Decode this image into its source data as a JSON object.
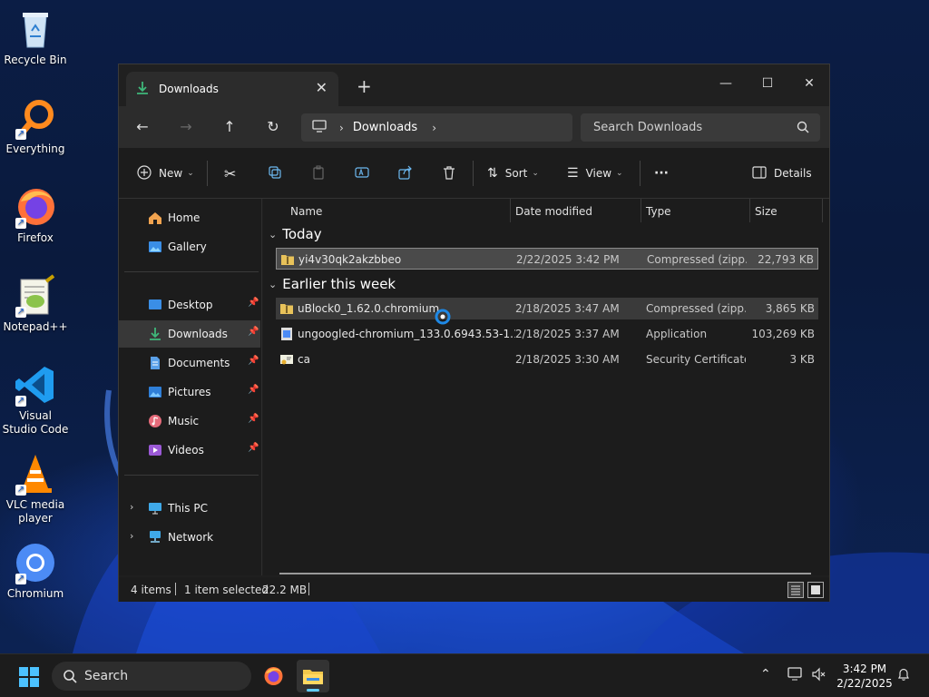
{
  "desktop": {
    "icons": [
      {
        "label": "Recycle Bin",
        "icon": "recycle-bin-icon"
      },
      {
        "label": "Everything",
        "icon": "everything-search-icon"
      },
      {
        "label": "Firefox",
        "icon": "firefox-icon"
      },
      {
        "label": "Notepad++",
        "icon": "notepad-plus-plus-icon"
      },
      {
        "label": "Visual Studio Code",
        "icon": "vscode-icon"
      },
      {
        "label": "VLC media player",
        "icon": "vlc-icon"
      },
      {
        "label": "Chromium",
        "icon": "chromium-icon"
      }
    ]
  },
  "window": {
    "tab_title": "Downloads",
    "address": {
      "segment": "Downloads"
    },
    "search_placeholder": "Search Downloads",
    "toolbar": {
      "new_label": "New",
      "sort_label": "Sort",
      "view_label": "View",
      "more_label": "···",
      "details_label": "Details"
    },
    "nav": {
      "home": "Home",
      "gallery": "Gallery",
      "desktop": "Desktop",
      "downloads": "Downloads",
      "documents": "Documents",
      "pictures": "Pictures",
      "music": "Music",
      "videos": "Videos",
      "this_pc": "This PC",
      "network": "Network"
    },
    "columns": {
      "name": "Name",
      "date": "Date modified",
      "type": "Type",
      "size": "Size"
    },
    "groups": {
      "today": {
        "label": "Today",
        "files": [
          {
            "name": "yi4v30qk2akzbbeo",
            "date": "2/22/2025 3:42 PM",
            "type": "Compressed (zipp...",
            "size": "22,793 KB"
          }
        ]
      },
      "earlier": {
        "label": "Earlier this week",
        "files": [
          {
            "name": "uBlock0_1.62.0.chromium",
            "date": "2/18/2025 3:47 AM",
            "type": "Compressed (zipp...",
            "size": "3,865 KB"
          },
          {
            "name": "ungoogled-chromium_133.0.6943.53-1.1...",
            "date": "2/18/2025 3:37 AM",
            "type": "Application",
            "size": "103,269 KB"
          },
          {
            "name": "ca",
            "date": "2/18/2025 3:30 AM",
            "type": "Security Certificate",
            "size": "3 KB"
          }
        ]
      }
    },
    "status": {
      "items": "4 items",
      "selected": "1 item selected",
      "sel_size": "22.2 MB"
    }
  },
  "taskbar": {
    "search_label": "Search",
    "time": "3:42 PM",
    "date": "2/22/2025"
  },
  "colors": {
    "accent": "#60cdff",
    "folder": "#e8c25a",
    "selected_row": "#4a4a4a"
  }
}
